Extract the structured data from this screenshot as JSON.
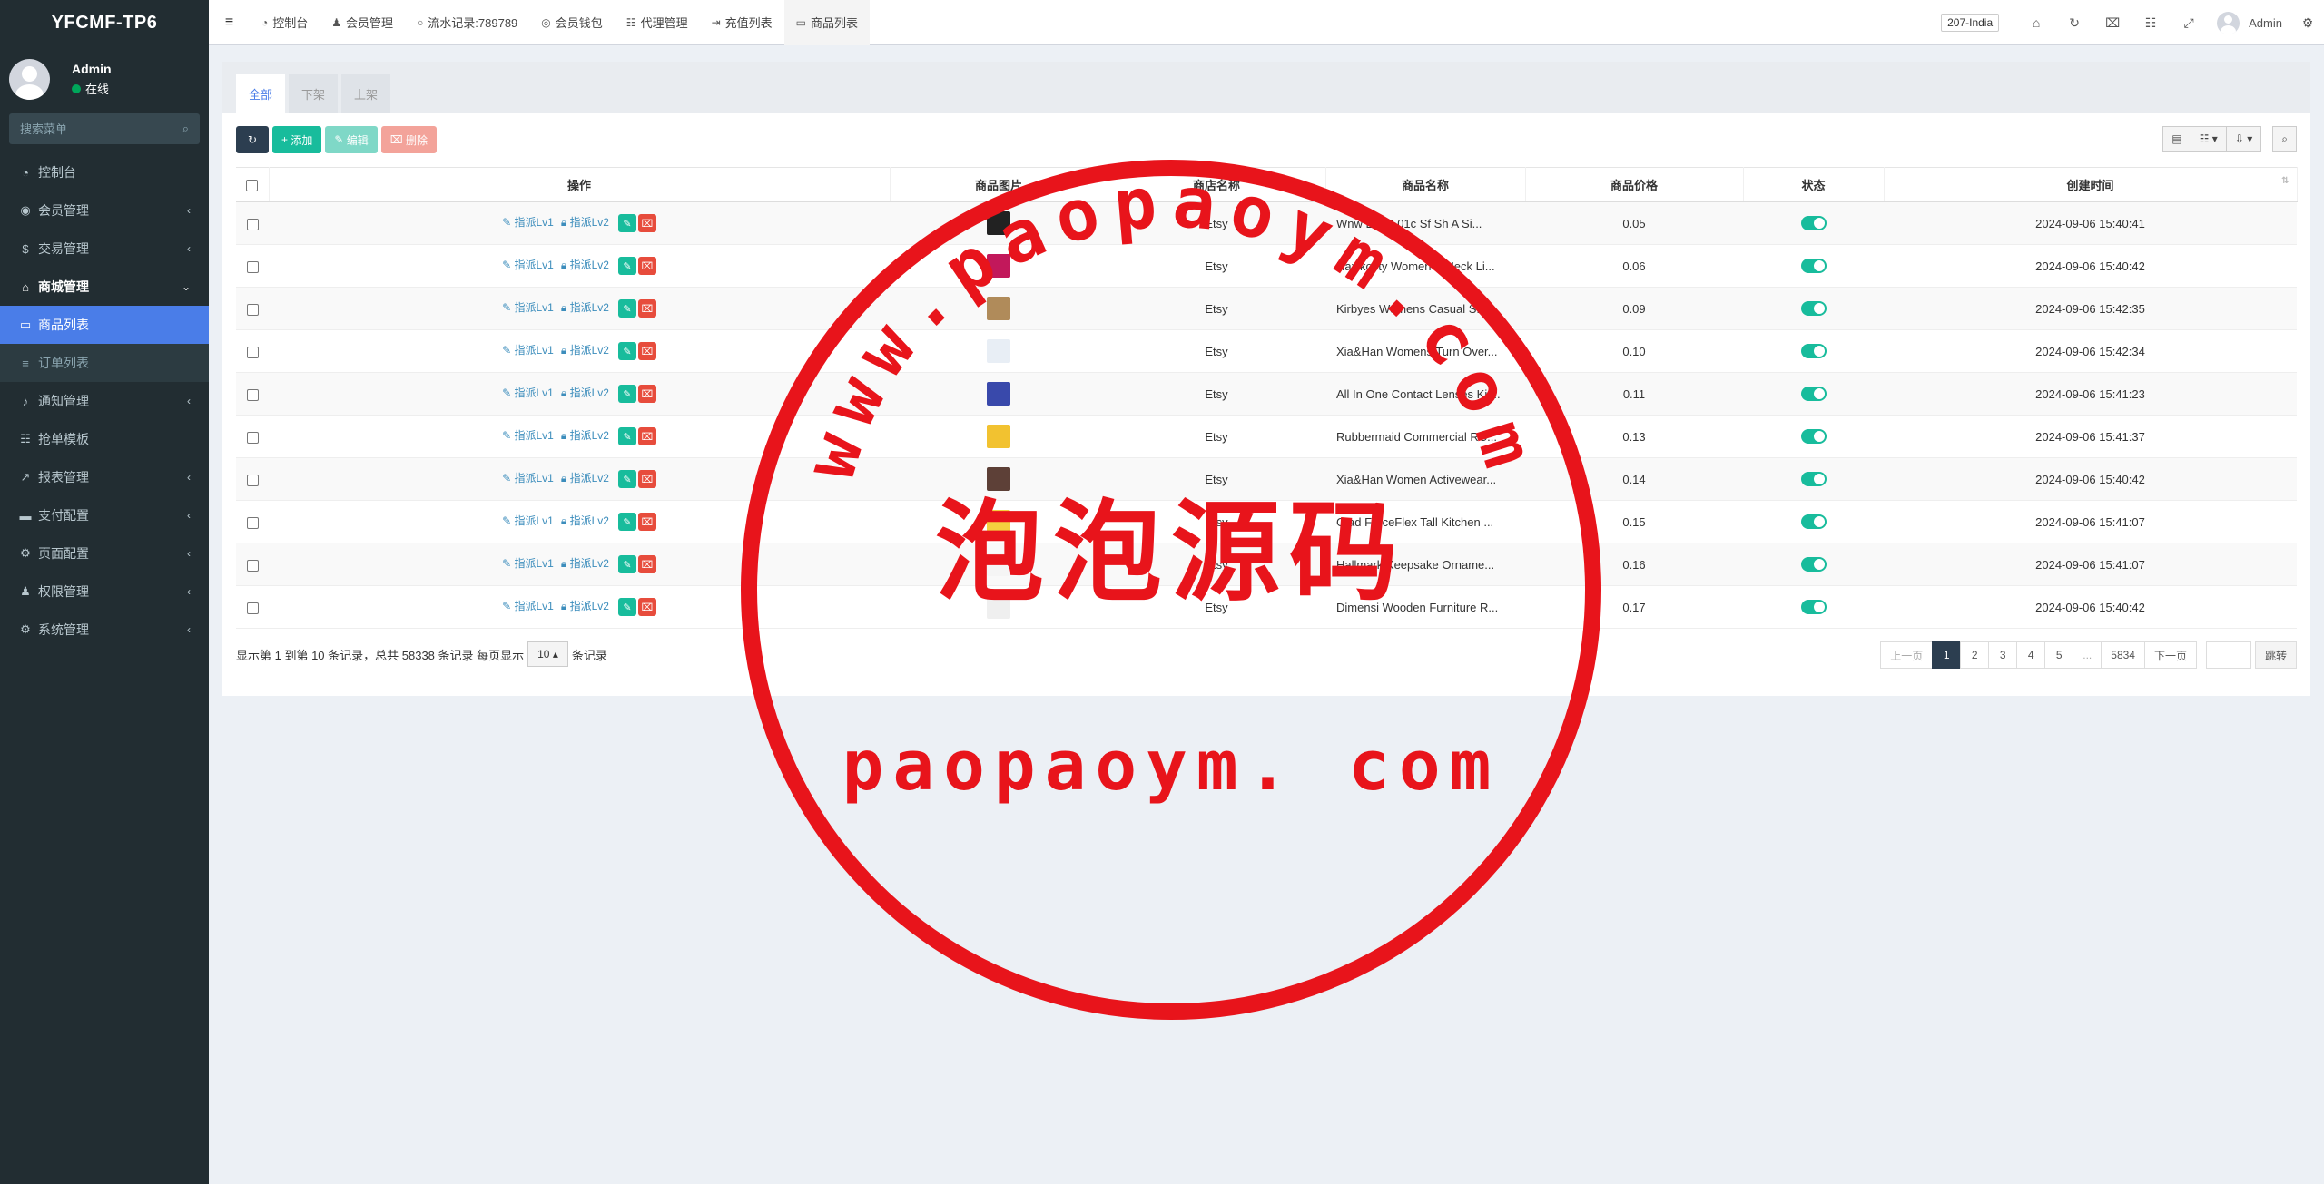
{
  "app": {
    "logo": "YFCMF-TP6"
  },
  "user": {
    "name": "Admin",
    "status": "在线"
  },
  "sidebar": {
    "search_placeholder": "搜索菜单",
    "items": [
      {
        "label": "控制台",
        "icon": "dashboard-icon"
      },
      {
        "label": "会员管理",
        "icon": "user-circle-icon"
      },
      {
        "label": "交易管理",
        "icon": "dollar-icon"
      },
      {
        "label": "商城管理",
        "icon": "home-icon"
      },
      {
        "label": "商品列表",
        "icon": "monitor-icon"
      },
      {
        "label": "订单列表",
        "icon": "list-icon"
      },
      {
        "label": "通知管理",
        "icon": "bell-icon"
      },
      {
        "label": "抢单模板",
        "icon": "sitemap-icon"
      },
      {
        "label": "报表管理",
        "icon": "chart-icon"
      },
      {
        "label": "支付配置",
        "icon": "card-icon"
      },
      {
        "label": "页面配置",
        "icon": "gear-icon"
      },
      {
        "label": "权限管理",
        "icon": "users-icon"
      },
      {
        "label": "系统管理",
        "icon": "cogs-icon"
      }
    ]
  },
  "navbar": {
    "tabs": [
      {
        "label": "控制台"
      },
      {
        "label": "会员管理"
      },
      {
        "label": "流水记录:789789"
      },
      {
        "label": "会员钱包"
      },
      {
        "label": "代理管理"
      },
      {
        "label": "充值列表"
      },
      {
        "label": "商品列表"
      }
    ],
    "region": "207-India",
    "user": "Admin"
  },
  "content_tabs": [
    "全部",
    "下架",
    "上架"
  ],
  "toolbar": {
    "add": "添加",
    "edit": "编辑",
    "delete": "删除"
  },
  "table": {
    "headers": [
      "操作",
      "商品图片",
      "商店名称",
      "商品名称",
      "商品价格",
      "状态",
      "创建时间"
    ],
    "op_lv1": "指派Lv1",
    "op_lv2": "指派Lv2",
    "rows": [
      {
        "shop": "Etsy",
        "name": "Wnw Lips 501c Sf Sh A Si...",
        "price": "0.05",
        "created": "2024-09-06 15:40:41",
        "thumb": "#222222"
      },
      {
        "shop": "Etsy",
        "name": "Haxikocty Women V-Neck Li...",
        "price": "0.06",
        "created": "2024-09-06 15:40:42",
        "thumb": "#c2185b"
      },
      {
        "shop": "Etsy",
        "name": "Kirbyes Womens Casual S...",
        "price": "0.09",
        "created": "2024-09-06 15:42:35",
        "thumb": "#b08b5a"
      },
      {
        "shop": "Etsy",
        "name": "Xia&Han Womens Turn Over...",
        "price": "0.10",
        "created": "2024-09-06 15:42:34",
        "thumb": "#e8eef5"
      },
      {
        "shop": "Etsy",
        "name": "All In One Contact Lenses Kit...",
        "price": "0.11",
        "created": "2024-09-06 15:41:23",
        "thumb": "#3949ab"
      },
      {
        "shop": "Etsy",
        "name": "Rubbermaid Commercial RC...",
        "price": "0.13",
        "created": "2024-09-06 15:41:37",
        "thumb": "#f2c230"
      },
      {
        "shop": "Etsy",
        "name": "Xia&Han Women Activewear...",
        "price": "0.14",
        "created": "2024-09-06 15:40:42",
        "thumb": "#5d4037"
      },
      {
        "shop": "Etsy",
        "name": "Glad ForceFlex Tall Kitchen ...",
        "price": "0.15",
        "created": "2024-09-06 15:41:07",
        "thumb": "#f4d03f"
      },
      {
        "shop": "Etsy",
        "name": "Hallmark Keepsake Orname...",
        "price": "0.16",
        "created": "2024-09-06 15:41:07",
        "thumb": "#f5f5f5"
      },
      {
        "shop": "Etsy",
        "name": "Dimensi Wooden Furniture R...",
        "price": "0.17",
        "created": "2024-09-06 15:40:42",
        "thumb": "#efefef"
      }
    ]
  },
  "footer": {
    "summary": "显示第 1 到第 10 条记录，总共 58338 条记录 每页显示",
    "page_size": "10",
    "suffix": "条记录",
    "pager": [
      "上一页",
      "1",
      "2",
      "3",
      "4",
      "5",
      "...",
      "5834",
      "下一页"
    ],
    "go": "跳转"
  },
  "watermark": {
    "ring_text": "www.paopaoym.com",
    "center_text": "泡泡源码",
    "bottom_text": "paopaoym. com",
    "color": "#e8141b"
  }
}
